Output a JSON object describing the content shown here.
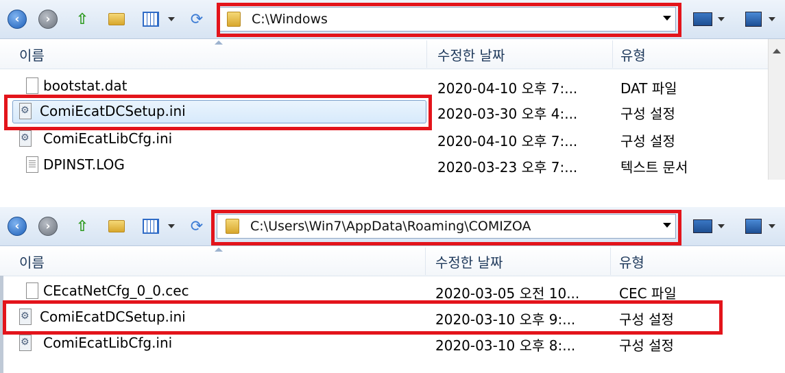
{
  "panels": [
    {
      "address": "C:\\Windows",
      "columns": {
        "name": "이름",
        "date": "수정한 날짜",
        "type": "유형"
      },
      "rows": [
        {
          "name": "bootstat.dat",
          "date": "2020-04-10 오후 7:...",
          "type": "DAT 파일",
          "icon": "blank-file-icon"
        },
        {
          "name": "ComiEcatDCSetup.ini",
          "date": "2020-03-30 오후 4:...",
          "type": "구성 설정",
          "icon": "ini-file-icon"
        },
        {
          "name": "ComiEcatLibCfg.ini",
          "date": "2020-04-10 오후 7:...",
          "type": "구성 설정",
          "icon": "ini-file-icon"
        },
        {
          "name": "DPINST.LOG",
          "date": "2020-03-23 오후 7:...",
          "type": "텍스트 문서",
          "icon": "text-file-icon"
        }
      ]
    },
    {
      "address": "C:\\Users\\Win7\\AppData\\Roaming\\COMIZOA",
      "columns": {
        "name": "이름",
        "date": "수정한 날짜",
        "type": "유형"
      },
      "rows": [
        {
          "name": "CEcatNetCfg_0_0.cec",
          "date": "2020-03-05 오전 10...",
          "type": "CEC 파일",
          "icon": "blank-file-icon"
        },
        {
          "name": "ComiEcatDCSetup.ini",
          "date": "2020-03-10 오후 9:...",
          "type": "구성 설정",
          "icon": "ini-file-icon"
        },
        {
          "name": "ComiEcatLibCfg.ini",
          "date": "2020-03-10 오후 8:...",
          "type": "구성 설정",
          "icon": "ini-file-icon"
        }
      ]
    }
  ],
  "colors": {
    "highlight": "#e3141b",
    "header_text": "#1e395b",
    "selection": "#d7eafc"
  }
}
